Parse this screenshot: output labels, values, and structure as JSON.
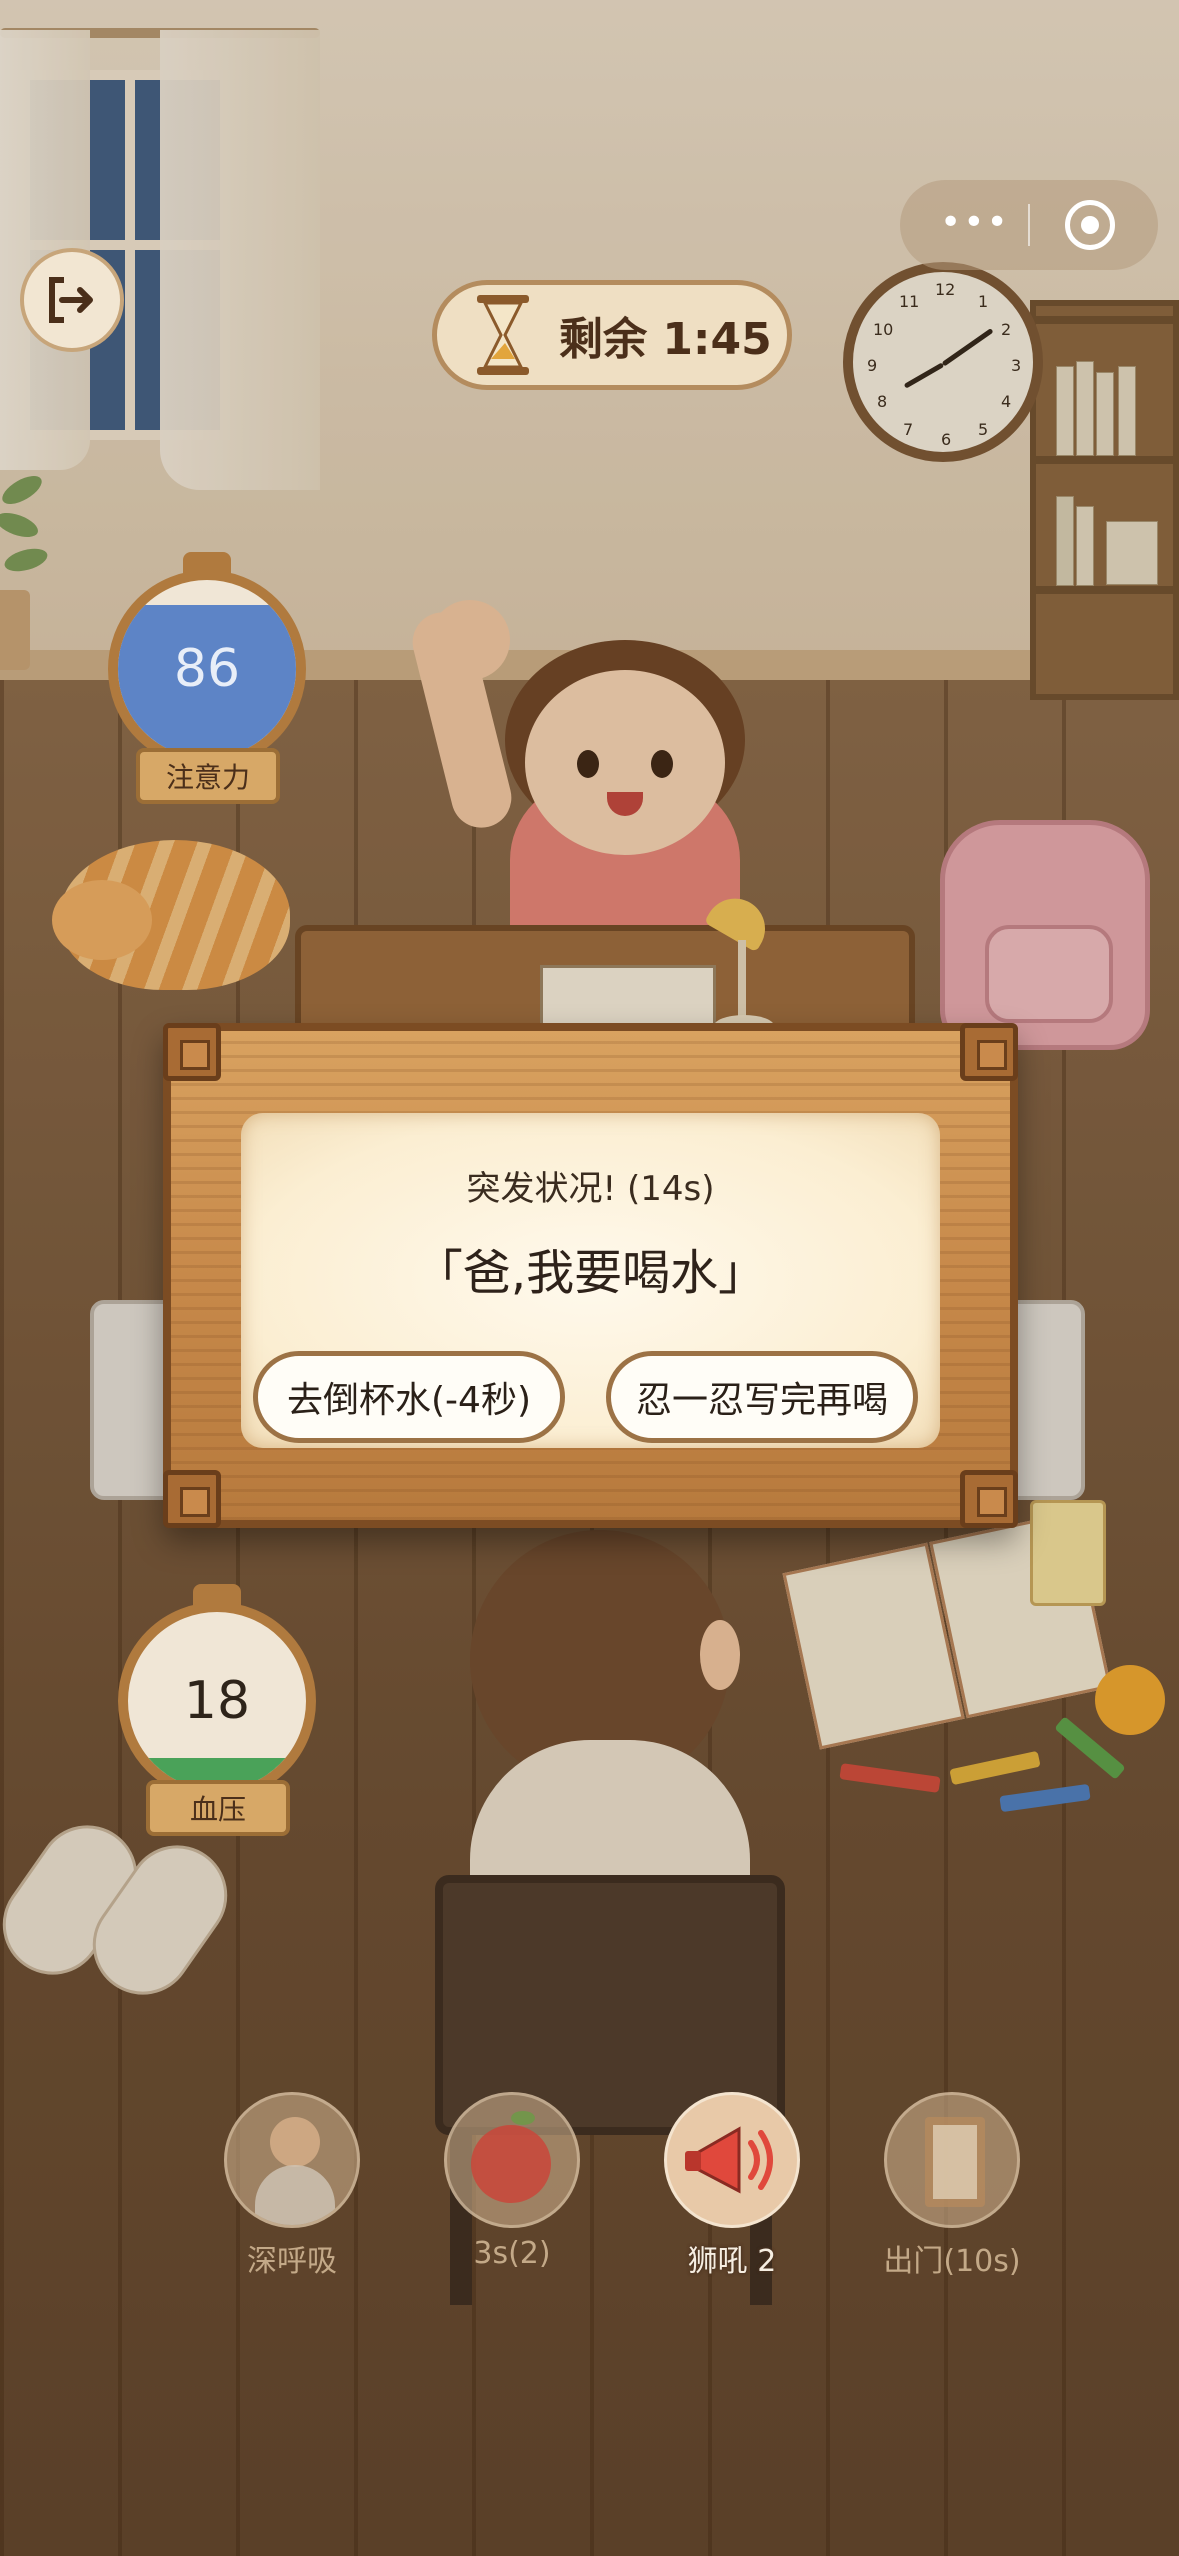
{
  "top_bar": {
    "timer_text": "剩余 1:45",
    "icons": {
      "exit": "exit-icon",
      "hourglass": "hourglass-icon",
      "more": "more-dots-icon",
      "close": "target-close-icon"
    }
  },
  "gauges": {
    "attention": {
      "label": "注意力",
      "value": "86",
      "level": 0.86,
      "color": "#5d84c6"
    },
    "blood_pressure": {
      "label": "血压",
      "value": "18",
      "level": 0.18,
      "color": "#4aa259"
    }
  },
  "event_dialog": {
    "title": "突发状况! (14s)",
    "message": "「爸,我要喝水」",
    "choices": [
      {
        "label": "去倒杯水(-4秒)"
      },
      {
        "label": "忍一忍写完再喝"
      }
    ]
  },
  "skills": [
    {
      "label": "深呼吸",
      "icon": "deep-breath-icon",
      "active": false
    },
    {
      "label": "3s(2)",
      "icon": "apple-icon",
      "active": false
    },
    {
      "label": "狮吼 2",
      "icon": "megaphone-icon",
      "active": true
    },
    {
      "label": "出门(10s)",
      "icon": "door-icon",
      "active": false
    }
  ],
  "clock_numbers": [
    "12",
    "1",
    "2",
    "3",
    "4",
    "5",
    "6",
    "7",
    "8",
    "9",
    "10",
    "11"
  ],
  "colors": {
    "wood": "#c7894a",
    "panel": "#fbeed2",
    "accent_text": "#4b2f1a"
  }
}
